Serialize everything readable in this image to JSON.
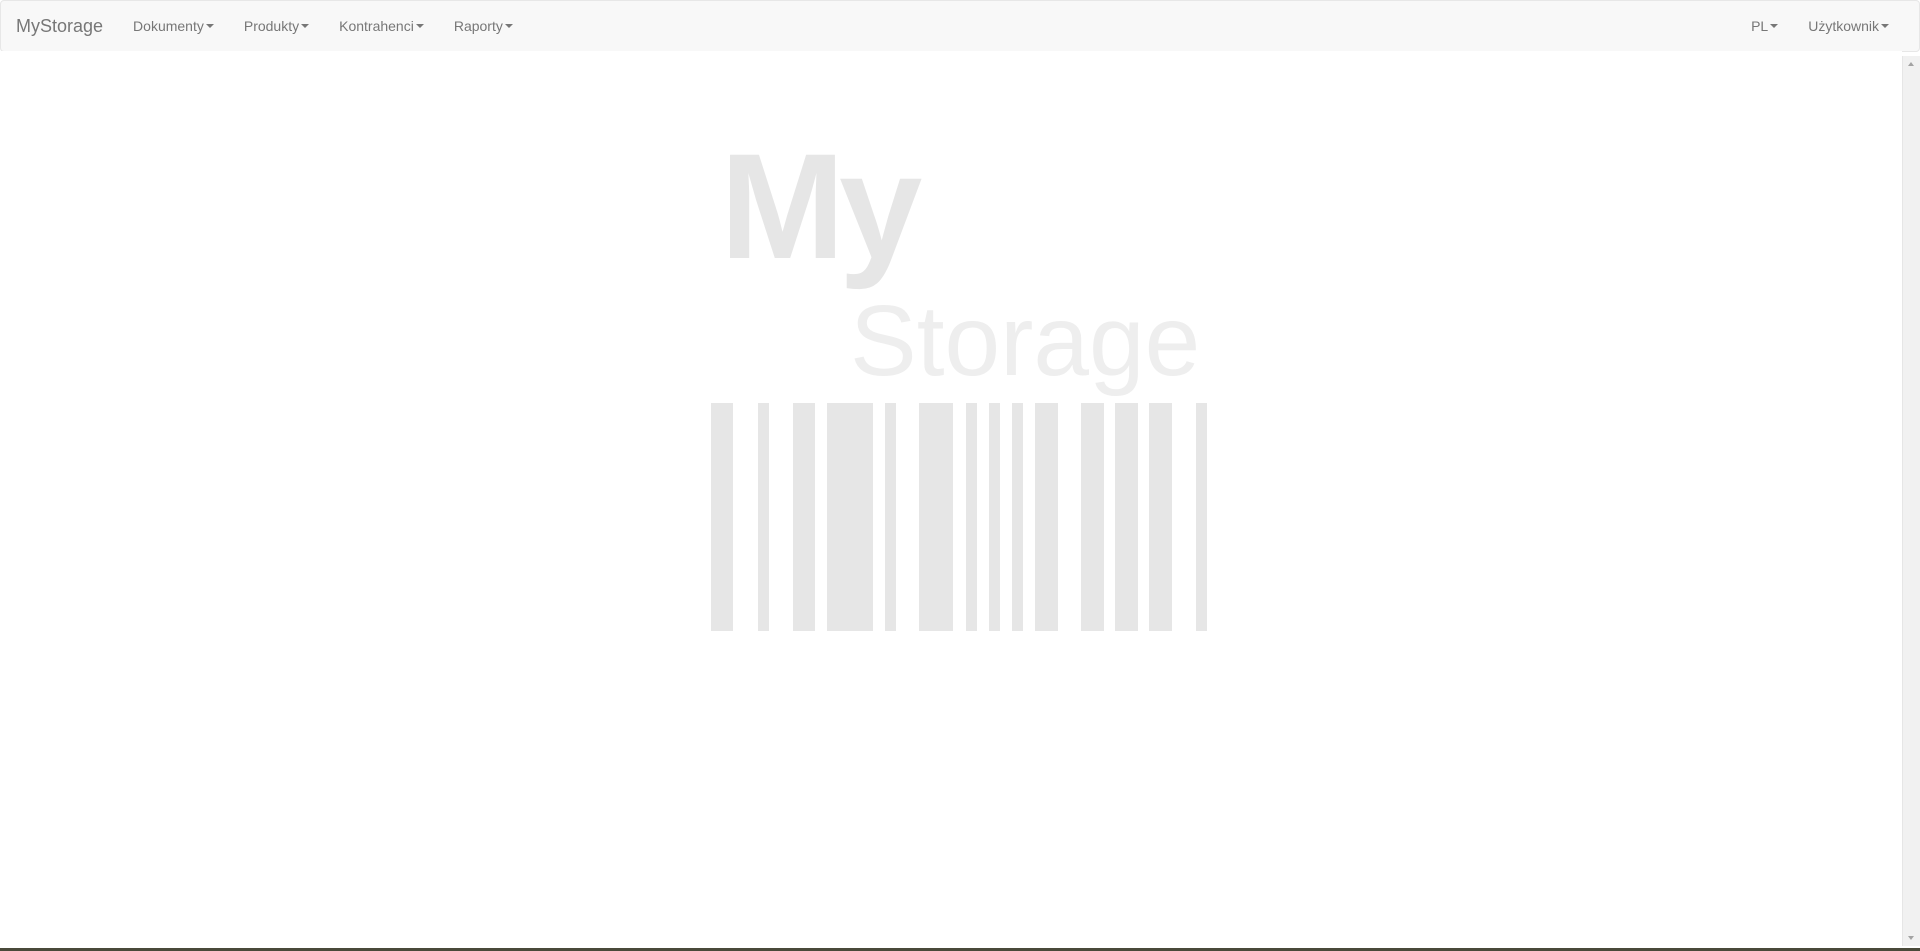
{
  "navbar": {
    "brand": "MyStorage",
    "menu": [
      {
        "label": "Dokumenty"
      },
      {
        "label": "Produkty"
      },
      {
        "label": "Kontrahenci"
      },
      {
        "label": "Raporty"
      }
    ],
    "language": "PL",
    "user": "Użytkownik"
  },
  "logo": {
    "line1": "My",
    "line2": "Storage"
  },
  "colors": {
    "navbar_bg": "#f8f8f8",
    "nav_text": "#777777",
    "logo_gray": "#e6e6e6"
  }
}
